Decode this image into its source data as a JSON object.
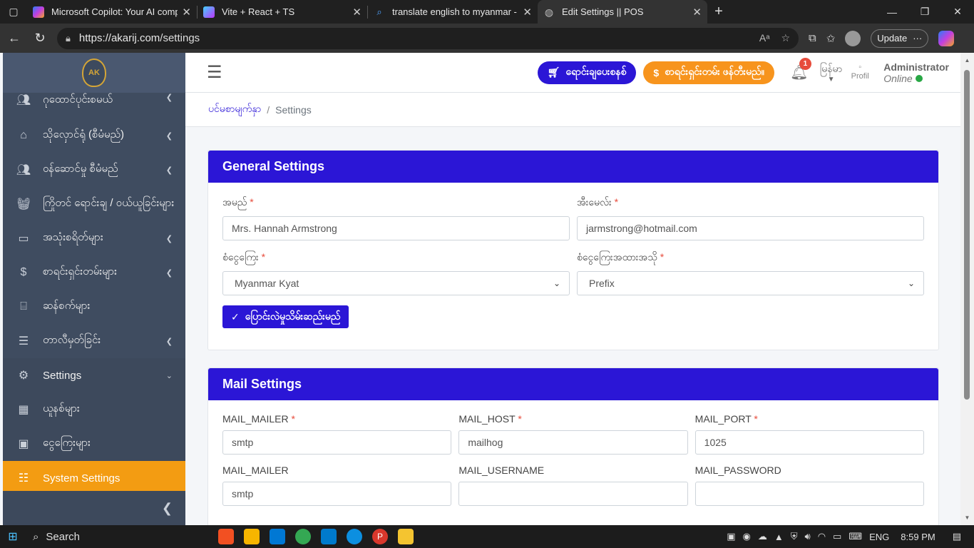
{
  "browser": {
    "tabs": [
      {
        "title": "Microsoft Copilot: Your AI compa",
        "color": "#c43ee0"
      },
      {
        "title": "Vite + React + TS",
        "color": "#8e5cf7"
      },
      {
        "title": "translate english to myanmar - Se",
        "color": "#2b7ce9"
      },
      {
        "title": "Edit Settings || POS",
        "color": "#888888"
      }
    ],
    "url_domain": "https://akarij.com",
    "url_path": "/settings",
    "update_label": "Update"
  },
  "sidebar": {
    "logo_text": "AK",
    "items": [
      {
        "label": "ဂုထောင်ပုင်းစမယ်",
        "icon": "users-icon"
      },
      {
        "label": "သိုလှောင်ရုံ (စီမံမည်)",
        "icon": "warehouse-icon"
      },
      {
        "label": "ဝန်ဆောင်မှု စီမံမည်",
        "icon": "users-icon"
      },
      {
        "label": "ကြိုတင် ရောင်းချ / ဝယ်ယူခြင်းများ",
        "icon": "basket-icon"
      },
      {
        "label": "အသုံးစရိတ်များ",
        "icon": "wallet-icon"
      },
      {
        "label": "စာရင်းရှင်းတမ်းများ",
        "icon": "dollar-icon"
      },
      {
        "label": "ဆန်စက်များ",
        "icon": "store-icon"
      },
      {
        "label": "တာလီမှတ်ခြင်း",
        "icon": "list-icon"
      },
      {
        "label": "Settings",
        "icon": "gear-icon"
      },
      {
        "label": "ယူနစ်များ",
        "icon": "calculator-icon"
      },
      {
        "label": "ငွေကြေးများ",
        "icon": "money-icon"
      },
      {
        "label": "System Settings",
        "icon": "sliders-icon"
      }
    ]
  },
  "topnav": {
    "pos_button": "ရောင်းချပေးစနစ်",
    "report_button": "စာရင်းရှင်းတမ်း ဖန်တီးမည်။",
    "notification_count": "1",
    "language": "မြန်မာ",
    "profile_alt": "Profil",
    "user_name": "Administrator",
    "user_status": "Online"
  },
  "breadcrumb": {
    "home": "ပင်မစာမျက်နှာ",
    "current": "Settings"
  },
  "general": {
    "title": "General Settings",
    "name_label": "အမည်",
    "name_value": "Mrs. Hannah Armstrong",
    "email_label": "အီးမေလ်း",
    "email_value": "jarmstrong@hotmail.com",
    "currency_label": "စံငွေကြေး",
    "currency_value": "Myanmar Kyat",
    "position_label": "စံငွေကြေးအထားအသို",
    "position_value": "Prefix",
    "save_label": "ပြောင်းလဲမှုသိမ်းဆည်းမည်"
  },
  "mail": {
    "title": "Mail Settings",
    "mailer_label": "MAIL_MAILER",
    "mailer_value": "smtp",
    "host_label": "MAIL_HOST",
    "host_value": "mailhog",
    "port_label": "MAIL_PORT",
    "port_value": "1025",
    "mailer2_label": "MAIL_MAILER",
    "mailer2_value": "smtp",
    "username_label": "MAIL_USERNAME",
    "username_value": "",
    "password_label": "MAIL_PASSWORD",
    "password_value": ""
  },
  "taskbar": {
    "search_label": "Search",
    "lang": "ENG",
    "time": "8:59 PM"
  },
  "colors": {
    "primary": "#2b16d6",
    "accent": "#f39c12",
    "sidebar": "#445268"
  }
}
